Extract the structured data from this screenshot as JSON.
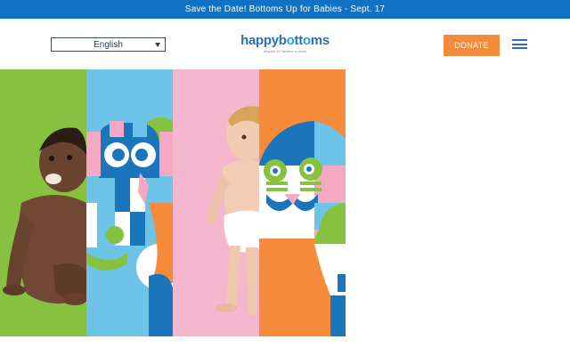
{
  "announcement": "Save the Date! Bottoms Up for Babies - Sept. 17",
  "language_select": {
    "selected": "English"
  },
  "logo": {
    "word_start": "happyb",
    "word_oo": "o",
    "word_tt": "tt",
    "word_oo2": "o",
    "word_end": "ms",
    "tagline": "diapers for families in need"
  },
  "donate_label": "DONATE",
  "hero": {
    "panels": [
      {
        "name": "baby-crawling",
        "color": "#86c140"
      },
      {
        "name": "elephant-illustration",
        "color": "#6ec3e9"
      },
      {
        "name": "baby-standing",
        "color": "#f4b7cd"
      },
      {
        "name": "lion-illustration",
        "color": "#f58b3b"
      }
    ]
  },
  "colors": {
    "brand_blue": "#0f72c4",
    "accent_orange": "#f38b3c",
    "logo_blue": "#2a6fb3"
  }
}
